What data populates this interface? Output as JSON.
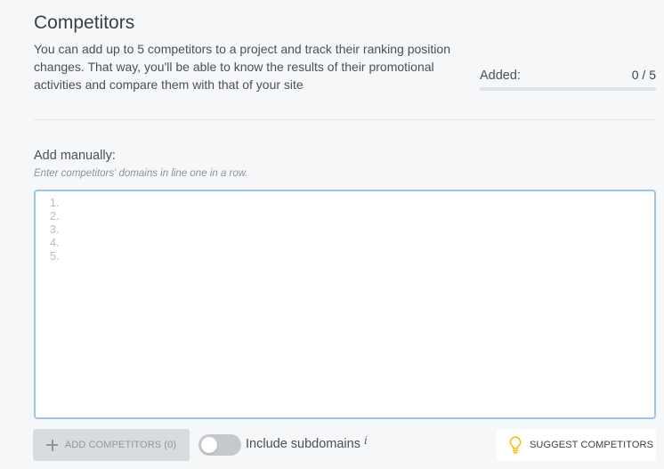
{
  "header": {
    "title": "Competitors",
    "description": "You can add up to 5 competitors to a project and track their ranking position changes. That way, you'll be able to know the results of their promotional activities and compare them with that of your site",
    "added_label": "Added:",
    "added_count": "0 / 5",
    "added_progress": 0
  },
  "manual": {
    "label": "Add manually:",
    "hint": "Enter competitors' domains in line one in a row.",
    "line_numbers": [
      "1.",
      "2.",
      "3.",
      "4.",
      "5."
    ]
  },
  "actions": {
    "add_button_label": "ADD COMPETITORS (0)",
    "include_subdomains_label": "Include subdomains",
    "include_subdomains_on": false,
    "info_glyph": "i",
    "suggest_button_label": "SUGGEST COMPETITORS",
    "suggest_icon": "lightbulb-icon",
    "suggest_icon_color": "#f5b800"
  }
}
